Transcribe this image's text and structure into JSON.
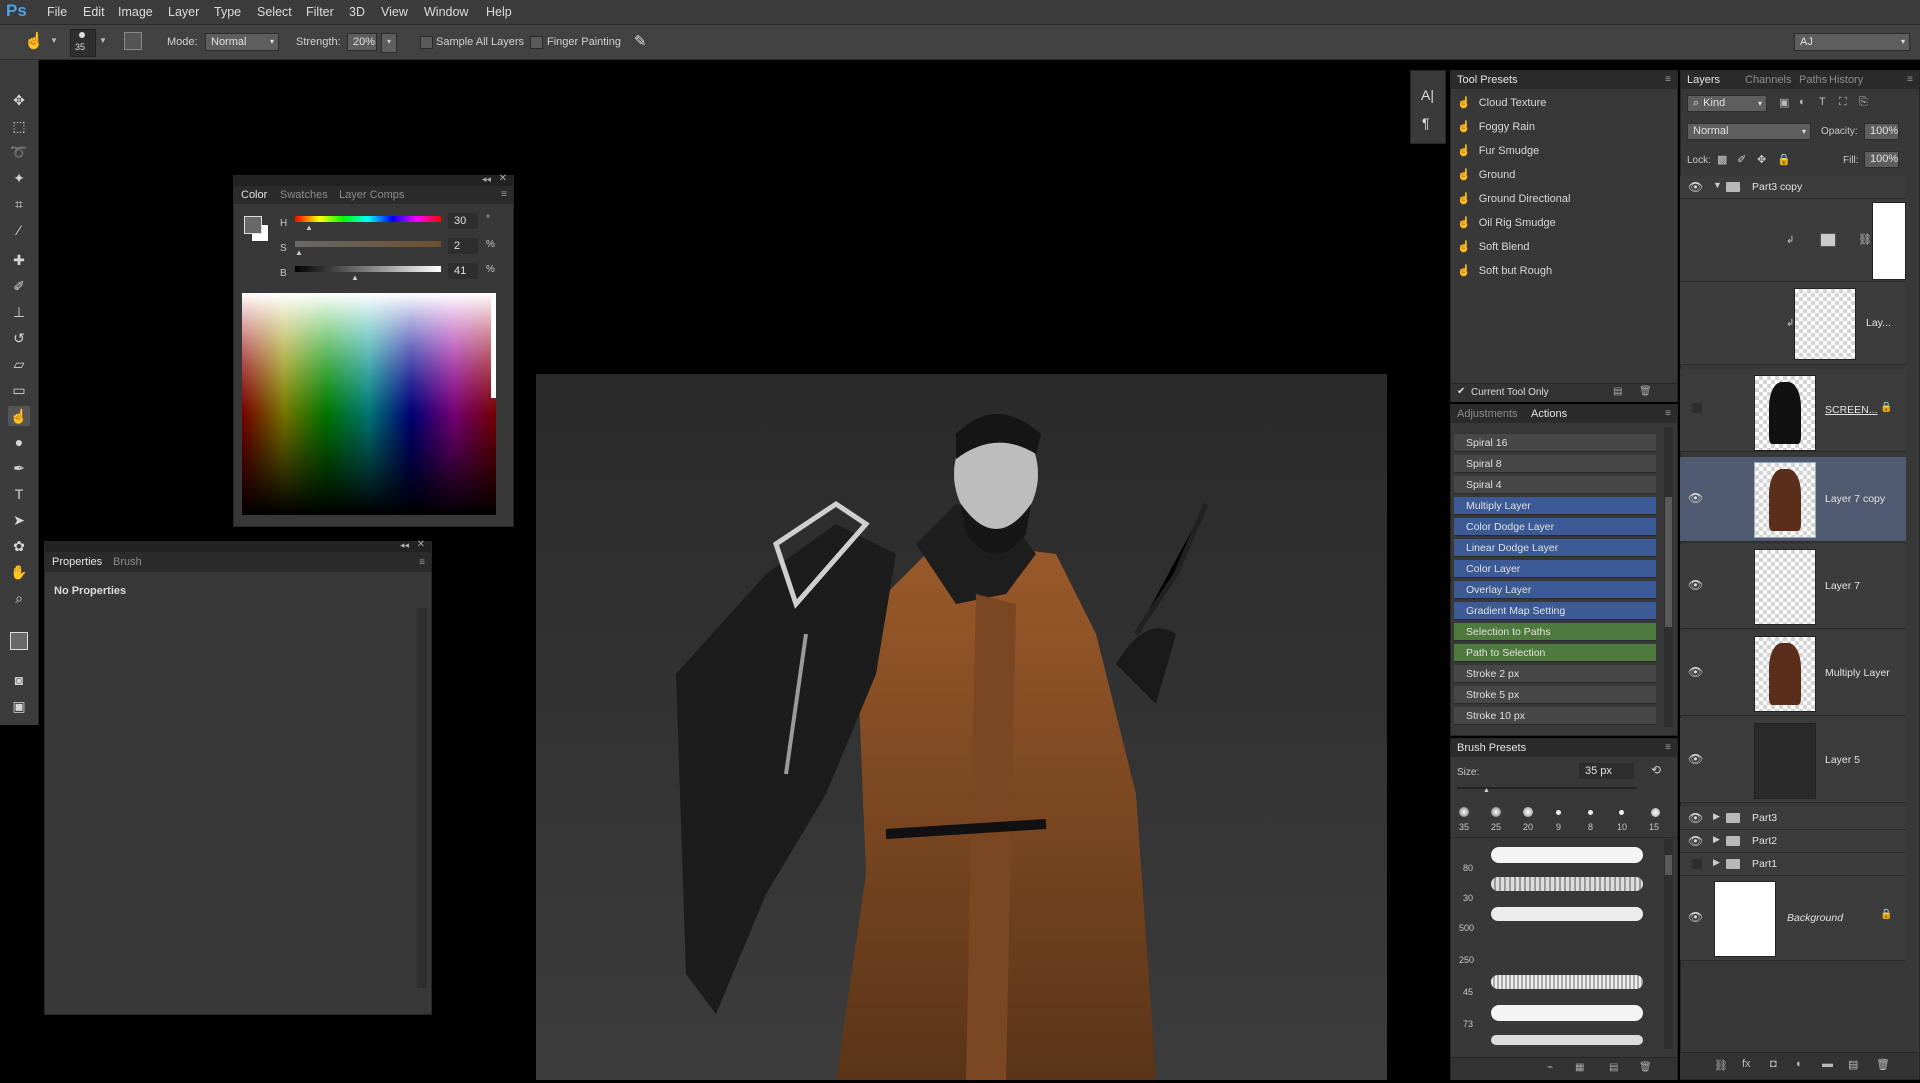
{
  "app": {
    "logo": "Ps"
  },
  "menu": [
    "File",
    "Edit",
    "Image",
    "Layer",
    "Type",
    "Select",
    "Filter",
    "3D",
    "View",
    "Window",
    "Help"
  ],
  "options": {
    "brush_size": "35",
    "mode_label": "Mode:",
    "mode_value": "Normal",
    "strength_label": "Strength:",
    "strength_value": "20%",
    "sample_all_layers": "Sample All Layers",
    "finger_painting": "Finger Painting",
    "workspace": "AJ"
  },
  "color_panel": {
    "tabs": [
      "Color",
      "Swatches",
      "Layer Comps"
    ],
    "h_label": "H",
    "h_value": "30",
    "h_unit": "°",
    "s_label": "S",
    "s_value": "2",
    "s_unit": "%",
    "b_label": "B",
    "b_value": "41",
    "b_unit": "%",
    "foreground": "#686868"
  },
  "properties_panel": {
    "tabs": [
      "Properties",
      "Brush"
    ],
    "message": "No Properties"
  },
  "tool_presets": {
    "title": "Tool Presets",
    "items": [
      "Cloud Texture",
      "Foggy Rain",
      "Fur Smudge",
      "Ground",
      "Ground Directional",
      "Oil Rig Smudge",
      "Soft Blend",
      "Soft but Rough"
    ],
    "current_tool_only": "Current Tool Only"
  },
  "actions_panel": {
    "tabs": [
      "Adjustments",
      "Actions"
    ],
    "items": [
      {
        "label": "Spiral 16",
        "color": "plain"
      },
      {
        "label": "Spiral 8",
        "color": "plain"
      },
      {
        "label": "Spiral 4",
        "color": "plain"
      },
      {
        "label": "Multiply Layer",
        "color": "blue"
      },
      {
        "label": "Color Dodge Layer",
        "color": "blue"
      },
      {
        "label": "Linear Dodge Layer",
        "color": "blue"
      },
      {
        "label": "Color Layer",
        "color": "blue"
      },
      {
        "label": "Overlay Layer",
        "color": "blue"
      },
      {
        "label": "Gradient Map Setting",
        "color": "blue"
      },
      {
        "label": "Selection to Paths",
        "color": "green"
      },
      {
        "label": "Path to Selection",
        "color": "green"
      },
      {
        "label": "Stroke 2 px",
        "color": "plain"
      },
      {
        "label": "Stroke 5 px",
        "color": "plain"
      },
      {
        "label": "Stroke 10 px",
        "color": "plain"
      }
    ]
  },
  "brush_presets": {
    "title": "Brush Presets",
    "size_label": "Size:",
    "size_value": "35 px",
    "round_sizes": [
      "35",
      "25",
      "20",
      "9",
      "8",
      "10",
      "15"
    ],
    "side_sizes": [
      "80",
      "30",
      "500",
      "250",
      "45",
      "73"
    ]
  },
  "layers_panel": {
    "tabs": [
      "Layers",
      "Channels",
      "Paths",
      "History"
    ],
    "filter": "Kind",
    "blend_mode": "Normal",
    "opacity_label": "Opacity:",
    "opacity_value": "100%",
    "lock_label": "Lock:",
    "fill_label": "Fill:",
    "fill_value": "100%",
    "group_open": "Part3 copy",
    "layers": [
      "Lay...",
      "SCREEN...",
      "Layer 7 copy",
      "Layer 7",
      "Multiply Layer",
      "Layer 5"
    ],
    "groups": [
      "Part3",
      "Part2",
      "Part1"
    ],
    "background": "Background"
  }
}
